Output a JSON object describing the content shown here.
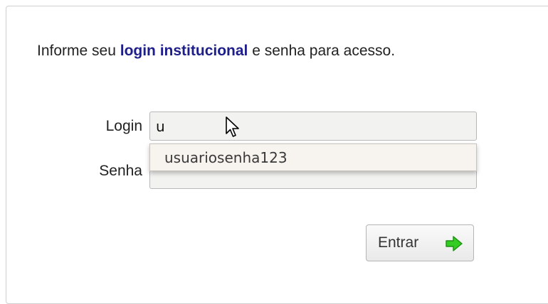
{
  "intro": {
    "prefix": "Informe seu ",
    "highlight": "login institucional",
    "suffix": " e senha para acesso."
  },
  "form": {
    "login_label": "Login",
    "login_value": "u",
    "password_label": "Senha",
    "password_value": ""
  },
  "autocomplete": {
    "items": [
      "usuariosenha123"
    ]
  },
  "submit": {
    "label": "Entrar",
    "icon": "arrow-right-icon"
  },
  "colors": {
    "highlight": "#1e1e8a",
    "arrow": "#33cc22",
    "input_bg": "#f2f2f0"
  }
}
